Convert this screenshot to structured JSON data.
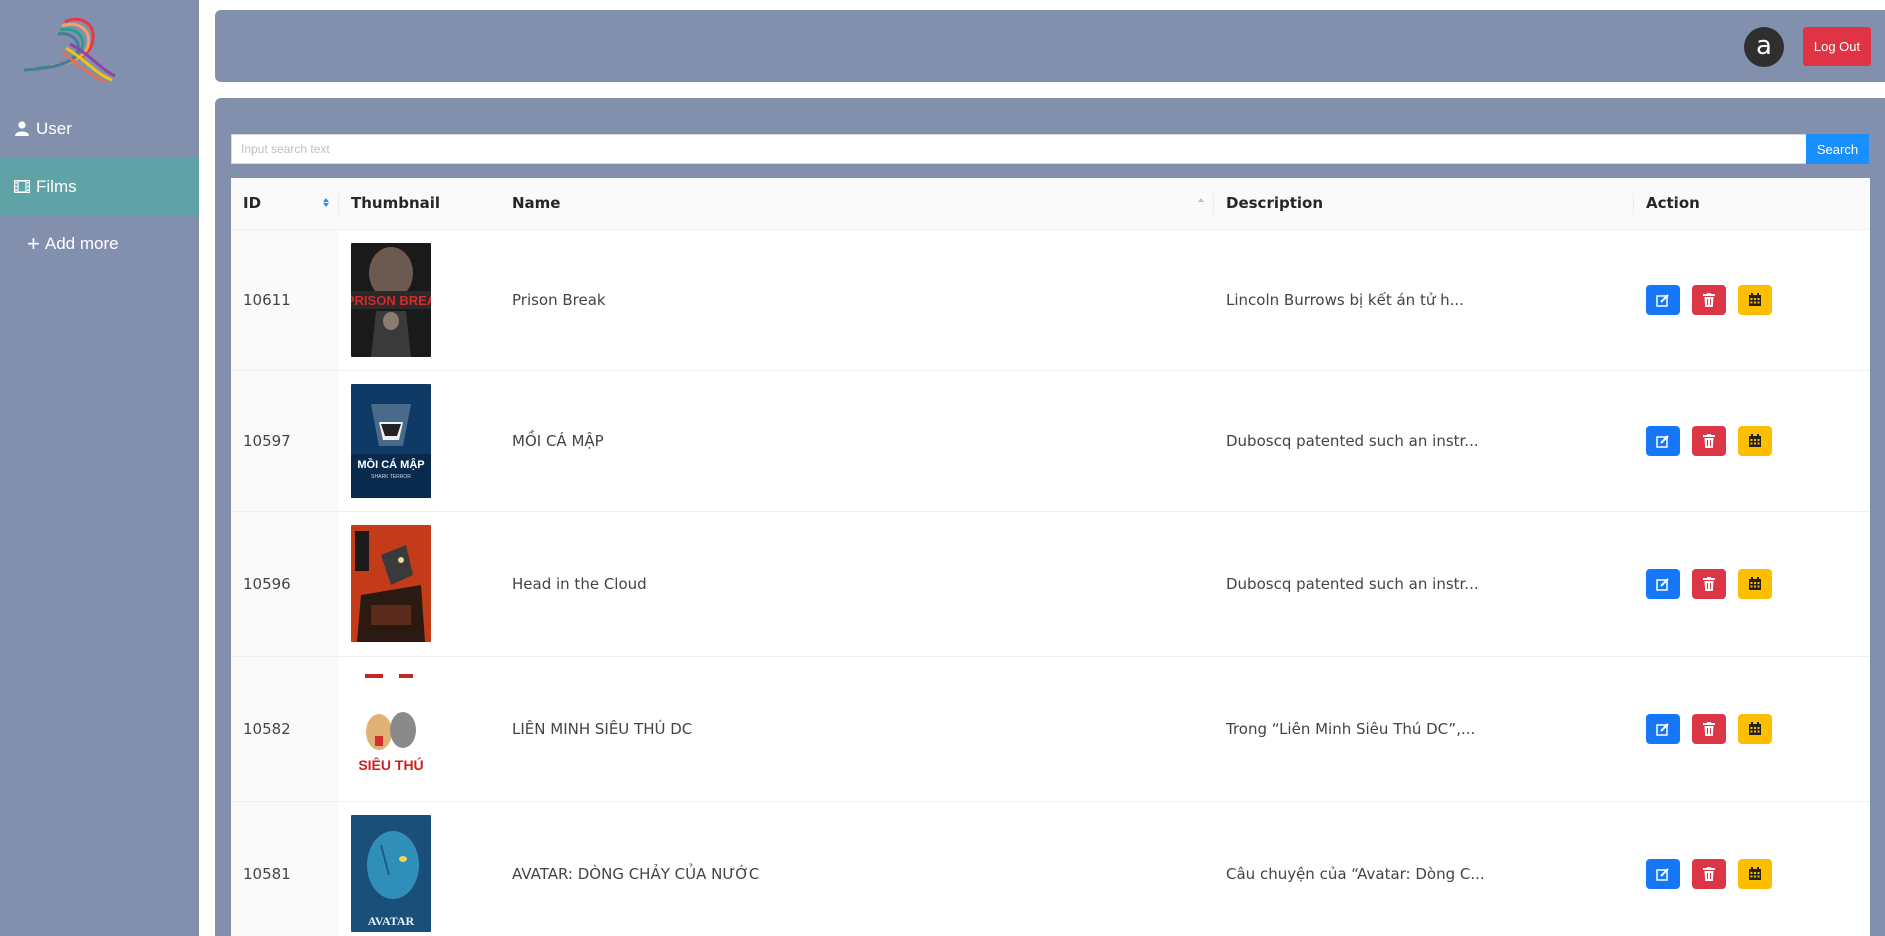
{
  "sidebar": {
    "items": [
      {
        "label": "User",
        "icon": "user-icon"
      },
      {
        "label": "Films",
        "icon": "film-icon",
        "active": true
      },
      {
        "label": "Add more",
        "icon": "plus-icon"
      }
    ]
  },
  "header": {
    "avatar_letter": "a",
    "logout_label": "Log Out"
  },
  "search": {
    "placeholder": "Input search text",
    "button_label": "Search"
  },
  "table": {
    "columns": [
      "ID",
      "Thumbnail",
      "Name",
      "Description",
      "Action"
    ],
    "rows": [
      {
        "id": "10611",
        "name": "Prison Break",
        "description": "Lincoln Burrows bị kết án tử h...",
        "poster": "prison-break-poster"
      },
      {
        "id": "10597",
        "name": "MỒI CÁ MẬP",
        "description": "Duboscq patented such an instr...",
        "poster": "shark-poster"
      },
      {
        "id": "10596",
        "name": "Head in the Cloud",
        "description": "Duboscq patented such an instr...",
        "poster": "kaiju-poster"
      },
      {
        "id": "10582",
        "name": "LIÊN MINH SIÊU THÚ DC",
        "description": "Trong “Liên Minh Siêu Thú DC”,...",
        "poster": "super-pets-poster"
      },
      {
        "id": "10581",
        "name": "AVATAR: DÒNG CHẢY CỦA NƯỚC",
        "description": "Câu chuyện của “Avatar: Dòng C...",
        "poster": "avatar-poster"
      }
    ]
  },
  "colors": {
    "sidebar_bg": "#8290ad",
    "active_nav": "#5fa3a6",
    "logout": "#e03444",
    "search_btn": "#1890ff",
    "edit_btn": "#1577f5",
    "delete_btn": "#dc3545",
    "calendar_btn": "#fdbe00"
  }
}
